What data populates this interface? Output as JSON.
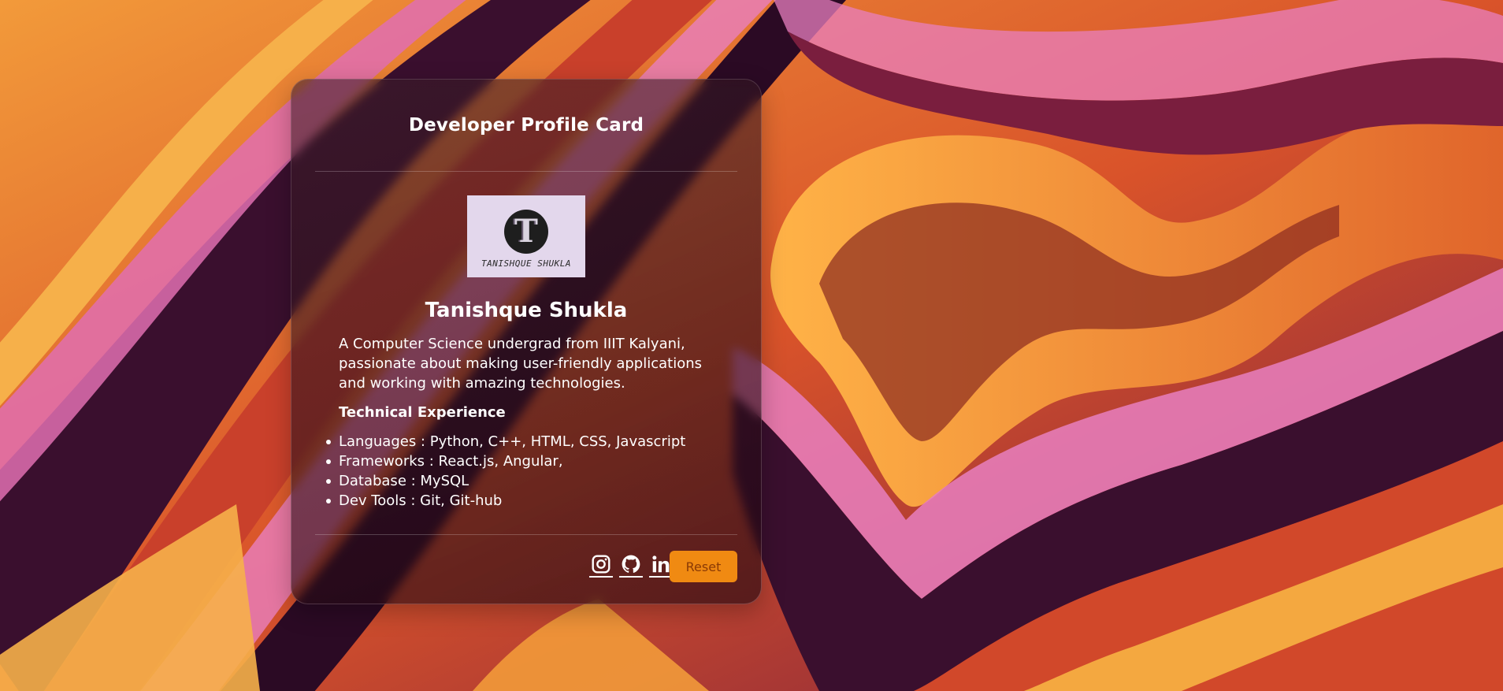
{
  "card": {
    "title": "Developer Profile Card",
    "avatar": {
      "letter": "T",
      "caption": "TANISHQUE SHUKLA"
    },
    "name": "Tanishque Shukla",
    "bio": "A Computer Science undergrad from IIIT Kalyani, passionate about making user-friendly applications and working with amazing technologies.",
    "tech_heading": "Technical Experience",
    "tech_items": [
      "Languages : Python, C++, HTML, CSS, Javascript",
      "Frameworks : React.js, Angular,",
      "Database : MySQL",
      "Dev Tools : Git, Git-hub"
    ],
    "footer": {
      "social": [
        {
          "icon": "instagram-icon"
        },
        {
          "icon": "github-icon"
        },
        {
          "icon": "linkedin-icon"
        }
      ],
      "reset_label": "Reset"
    }
  },
  "colors": {
    "accent": "#f08a12",
    "reset_text": "#8a3a05",
    "card_bg": "#28081466",
    "text": "#ffffff",
    "avatar_bg": "#e3d7ec"
  }
}
